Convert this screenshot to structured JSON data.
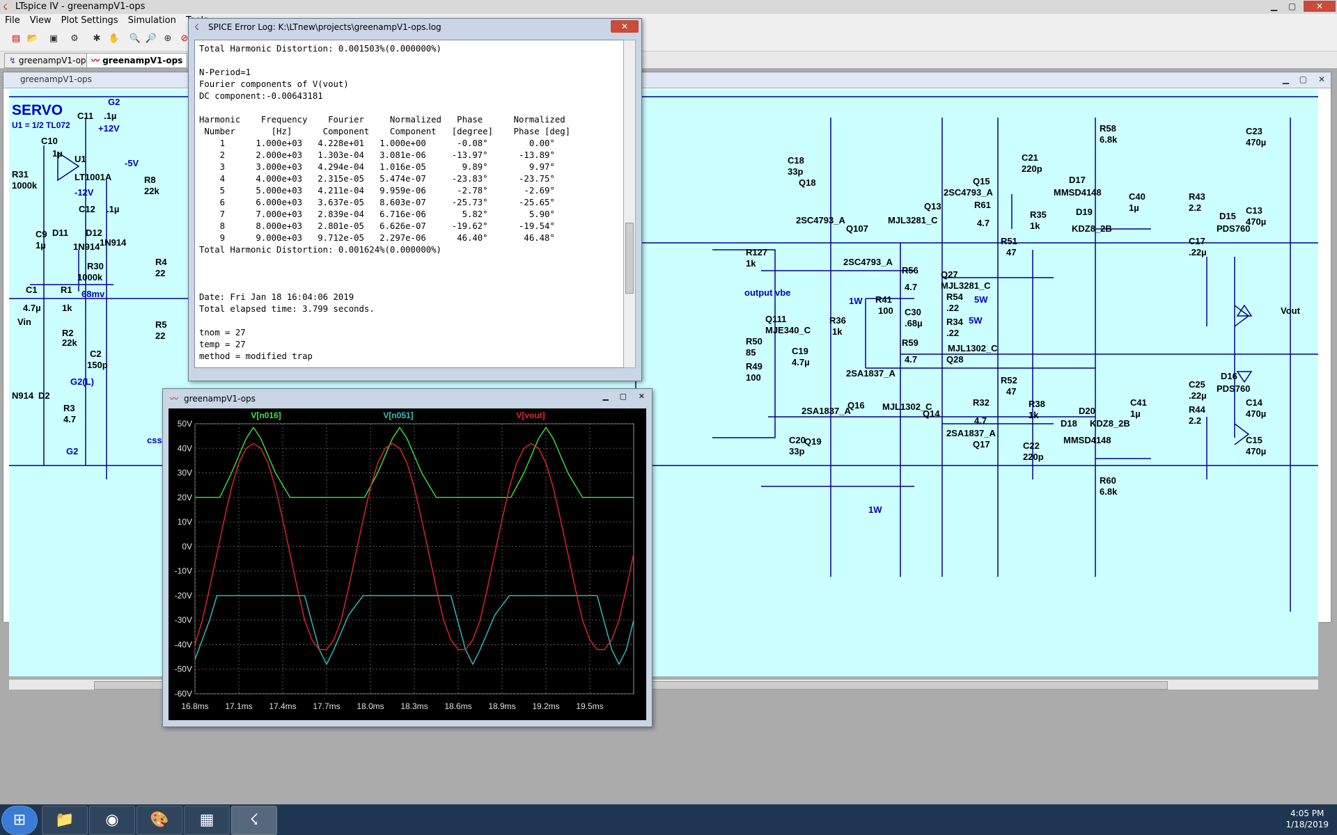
{
  "app": {
    "title": "LTspice IV - greenampV1-ops"
  },
  "menu": [
    "File",
    "View",
    "Plot Settings",
    "Simulation",
    "Tools"
  ],
  "tabs": [
    "greenampV1-ops",
    "greenampV1-ops"
  ],
  "schematic": {
    "title": "greenampV1-ops",
    "labels": {
      "servo": "SERVO",
      "u1note": "U1 = 1/2 TL072",
      "c11": "C11",
      "c11v": ".1µ",
      "g2a": "G2",
      "p12": "+12V",
      "c10": "C10",
      "c10v": "1µ",
      "u1": "U1",
      "m5": "-5V",
      "r31": "R31",
      "r31v": "1000k",
      "lt": "LT1001A",
      "r8": "R8",
      "r8v": "22k",
      "m12": "-12V",
      "c12": "C12",
      "c12v": ".1µ",
      "c9": "C9",
      "c9v": "1µ",
      "d11": "D11",
      "d12": "D12",
      "d12v": "1N914",
      "n914": "1N914",
      "r4": "R4",
      "r4v": "22",
      "r30": "R30",
      "r30v": "1000k",
      "c1": "C1",
      "c1v": "4.7µ",
      "r1": "R1",
      "r1v": "1k",
      "mv": "68mv",
      "vin": "Vin",
      "r2": "R2",
      "r2v": "22k",
      "c2": "C2",
      "c2v": "150p",
      "r5": "R5",
      "r5v": "22",
      "g2l": "G2(L)",
      "n914b": "N914",
      "d2": "D2",
      "r3": "R3",
      "r3v": "4.7",
      "g2b": "G2",
      "css": "css",
      "c18": "C18",
      "c18v": "33p",
      "q18": "Q18",
      "sc1": "2SC4793_A",
      "q107": "Q107",
      "mjl1": "MJL3281_C",
      "q13": "Q13",
      "sc2": "2SC4793_A",
      "q15": "Q15",
      "c21": "C21",
      "c21v": "220p",
      "d17": "D17",
      "mm1": "MMSD4148",
      "c40": "C40",
      "c40v": "1µ",
      "r58": "R58",
      "r58v": "6.8k",
      "c23": "C23",
      "c23v": "470µ",
      "r61": "R61",
      "r61v": "4.7",
      "r35": "R35",
      "r35v": "1k",
      "d19": "D19",
      "kdz1": "KDZ8_2B",
      "r43": "R43",
      "r43v": "2.2",
      "d15": "D15",
      "pds1": "PDS760",
      "c13": "C13",
      "c13v": "470µ",
      "r51": "R51",
      "r51v": "47",
      "c17": "C17",
      "c17v": ".22µ",
      "r127": "R127",
      "r127v": "1k",
      "sc3": "2SC4793_A",
      "r56": "R56",
      "r56v": "4.7",
      "q27": "Q27",
      "mjl2": "MJL3281_C",
      "ovbe": "output vbe",
      "w1a": "1W",
      "r41": "R41",
      "r41v": "100",
      "c30": "C30",
      "c30v": ".68µ",
      "r54": "R54",
      "r54v": ".22",
      "w5a": "5W",
      "vout": "Vout",
      "q111": "Q111",
      "mje": "MJE340_C",
      "r36": "R36",
      "r36v": "1k",
      "r34": "R34",
      "r34v": ".22",
      "w5b": "5W",
      "r50": "R50",
      "r50v": "85",
      "r59": "R59",
      "r59v": "4.7",
      "mjl3": "MJL1302_C",
      "q28": "Q28",
      "c19": "C19",
      "c19v": "4.7µ",
      "r49": "R49",
      "r49v": "100",
      "sa1": "2SA1837_A",
      "r52": "R52",
      "r52v": "47",
      "d16": "D16",
      "c25": "C25",
      "c25v": ".22µ",
      "pds2": "PDS760",
      "q16": "Q16",
      "mjl4": "MJL1302_C",
      "r32": "R32",
      "r32v": "4.7",
      "r38": "R38",
      "r38v": "1k",
      "d20": "D20",
      "c41": "C41",
      "c41v": "1µ",
      "c14": "C14",
      "c14v": "470µ",
      "sa2": "2SA1837_A",
      "q14": "Q14",
      "r44": "R44",
      "r44v": "2.2",
      "d18": "D18",
      "kdz2": "KDZ8_2B",
      "sa3": "2SA1837_A",
      "mm2": "MMSD4148",
      "c20": "C20",
      "c20v": "33p",
      "q19": "Q19",
      "q17": "Q17",
      "c22": "C22",
      "c22v": "220p",
      "c15": "C15",
      "c15v": "470µ",
      "r60": "R60",
      "r60v": "6.8k",
      "w1b": "1W"
    }
  },
  "error_log": {
    "title": "SPICE Error Log: K:\\LTnew\\projects\\greenampV1-ops.log",
    "text": "Total Harmonic Distortion: 0.001503%(0.000000%)\n\nN-Period=1\nFourier components of V(vout)\nDC component:-0.00643181\n\nHarmonic    Frequency    Fourier     Normalized   Phase      Normalized\n Number       [Hz]      Component    Component   [degree]    Phase [deg]\n    1      1.000e+03   4.228e+01   1.000e+00      -0.08°        0.00°\n    2      2.000e+03   1.303e-04   3.081e-06     -13.97°      -13.89°\n    3      3.000e+03   4.294e-04   1.016e-05       9.89°        9.97°\n    4      4.000e+03   2.315e-05   5.474e-07     -23.83°      -23.75°\n    5      5.000e+03   4.211e-04   9.959e-06      -2.78°       -2.69°\n    6      6.000e+03   3.637e-05   8.603e-07     -25.73°      -25.65°\n    7      7.000e+03   2.839e-04   6.716e-06       5.82°        5.90°\n    8      8.000e+03   2.801e-05   6.626e-07     -19.62°      -19.54°\n    9      9.000e+03   9.712e-05   2.297e-06      46.40°       46.48°\nTotal Harmonic Distortion: 0.001624%(0.000000%)\n\n\n\nDate: Fri Jan 18 16:04:06 2019\nTotal elapsed time: 3.799 seconds.\n\ntnom = 27\ntemp = 27\nmethod = modified trap"
  },
  "plot_window": {
    "title": "greenampV1-ops"
  },
  "chart_data": {
    "type": "line",
    "title": "",
    "xlabel": "",
    "ylabel": "",
    "xlim": [
      16.8,
      19.8
    ],
    "ylim": [
      -60,
      50
    ],
    "xticks": [
      "16.8ms",
      "17.1ms",
      "17.4ms",
      "17.7ms",
      "18.0ms",
      "18.3ms",
      "18.6ms",
      "18.9ms",
      "19.2ms",
      "19.5ms"
    ],
    "yticks": [
      "50V",
      "40V",
      "30V",
      "20V",
      "10V",
      "0V",
      "-10V",
      "-20V",
      "-30V",
      "-40V",
      "-50V",
      "-60V"
    ],
    "background": "#000000",
    "grid": true,
    "series": [
      {
        "name": "V[n016]",
        "color": "#39e64a",
        "x": [
          16.8,
          16.9,
          16.97,
          17.05,
          17.15,
          17.2,
          17.25,
          17.35,
          17.45,
          17.55,
          17.62,
          17.7,
          17.8,
          17.87,
          17.96,
          18.05,
          18.15,
          18.2,
          18.25,
          18.35,
          18.45,
          18.55,
          18.62,
          18.7,
          18.8,
          18.87,
          18.96,
          19.05,
          19.15,
          19.2,
          19.25,
          19.35,
          19.45,
          19.55,
          19.62,
          19.7,
          19.8
        ],
        "y": [
          20,
          20,
          20,
          30,
          44,
          48.5,
          44,
          30,
          20,
          20,
          20,
          20,
          20,
          20,
          20,
          30,
          44,
          48.5,
          44,
          30,
          20,
          20,
          20,
          20,
          20,
          20,
          20,
          30,
          44,
          48.5,
          44,
          30,
          20,
          20,
          20,
          20,
          20
        ]
      },
      {
        "name": "V[n051]",
        "color": "#2fc4c4",
        "x": [
          16.8,
          16.9,
          16.95,
          17.05,
          17.15,
          17.2,
          17.25,
          17.35,
          17.45,
          17.55,
          17.65,
          17.7,
          17.75,
          17.85,
          17.95,
          18.05,
          18.15,
          18.2,
          18.25,
          18.35,
          18.45,
          18.55,
          18.65,
          18.7,
          18.75,
          18.85,
          18.95,
          19.05,
          19.15,
          19.2,
          19.25,
          19.35,
          19.45,
          19.55,
          19.65,
          19.7,
          19.75,
          19.8
        ],
        "y": [
          -46,
          -30,
          -20,
          -20,
          -20,
          -20,
          -20,
          -20,
          -20,
          -20,
          -42,
          -48,
          -42,
          -28,
          -20,
          -20,
          -20,
          -20,
          -20,
          -20,
          -20,
          -20,
          -42,
          -48,
          -42,
          -28,
          -20,
          -20,
          -20,
          -20,
          -20,
          -20,
          -20,
          -20,
          -42,
          -48,
          -42,
          -30
        ]
      },
      {
        "name": "V[vout]",
        "color": "#e5262a",
        "x": [
          16.8,
          16.85,
          16.9,
          16.95,
          17.0,
          17.05,
          17.1,
          17.15,
          17.2,
          17.25,
          17.3,
          17.35,
          17.4,
          17.45,
          17.5,
          17.55,
          17.6,
          17.65,
          17.7,
          17.75,
          17.8,
          17.85,
          17.9,
          17.95,
          18.0,
          18.05,
          18.1,
          18.15,
          18.2,
          18.25,
          18.3,
          18.35,
          18.4,
          18.45,
          18.5,
          18.55,
          18.6,
          18.65,
          18.7,
          18.75,
          18.8,
          18.85,
          18.9,
          18.95,
          19.0,
          19.05,
          19.1,
          19.15,
          19.2,
          19.25,
          19.3,
          19.35,
          19.4,
          19.45,
          19.5,
          19.55,
          19.6,
          19.65,
          19.7,
          19.75,
          19.8
        ],
        "y": [
          -40,
          -30,
          -17,
          -3,
          11,
          24,
          34,
          40,
          42,
          40,
          34,
          24,
          11,
          -3,
          -17,
          -30,
          -38,
          -42,
          -42,
          -38,
          -30,
          -17,
          -3,
          11,
          24,
          34,
          40,
          42,
          40,
          34,
          24,
          11,
          -3,
          -17,
          -30,
          -38,
          -42,
          -42,
          -38,
          -30,
          -17,
          -3,
          11,
          24,
          34,
          40,
          42,
          40,
          34,
          24,
          11,
          -3,
          -17,
          -30,
          -38,
          -42,
          -42,
          -38,
          -30,
          -17,
          -3
        ]
      }
    ]
  },
  "taskbar": {
    "time": "4:05 PM",
    "date": "1/18/2019"
  }
}
